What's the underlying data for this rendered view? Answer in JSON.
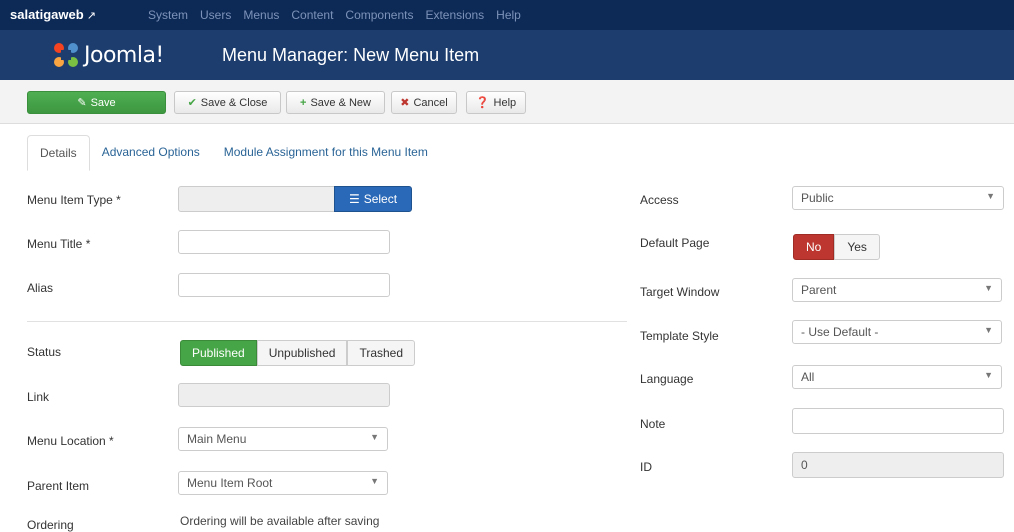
{
  "topnav": {
    "site": "salatigaweb",
    "external_icon": "external-link-icon",
    "menu": [
      "System",
      "Users",
      "Menus",
      "Content",
      "Components",
      "Extensions",
      "Help"
    ]
  },
  "header": {
    "logo_text": "Joomla!",
    "title": "Menu Manager: New Menu Item"
  },
  "toolbar": {
    "save": "Save",
    "save_close": "Save & Close",
    "save_new": "Save & New",
    "cancel": "Cancel",
    "help": "Help"
  },
  "tabs": [
    "Details",
    "Advanced Options",
    "Module Assignment for this Menu Item"
  ],
  "left": {
    "menu_item_type_label": "Menu Item Type *",
    "select_label": "Select",
    "menu_title_label": "Menu Title *",
    "alias_label": "Alias",
    "status_label": "Status",
    "status_options": [
      "Published",
      "Unpublished",
      "Trashed"
    ],
    "link_label": "Link",
    "menu_location_label": "Menu Location *",
    "menu_location_value": "Main Menu",
    "parent_item_label": "Parent Item",
    "parent_item_value": "Menu Item Root",
    "ordering_label": "Ordering",
    "ordering_note": "Ordering will be available after saving"
  },
  "right": {
    "access_label": "Access",
    "access_value": "Public",
    "default_page_label": "Default Page",
    "default_no": "No",
    "default_yes": "Yes",
    "target_window_label": "Target Window",
    "target_window_value": "Parent",
    "template_style_label": "Template Style",
    "template_style_value": "- Use Default -",
    "language_label": "Language",
    "language_value": "All",
    "note_label": "Note",
    "id_label": "ID",
    "id_value": "0"
  },
  "colors": {
    "topnav_bg": "#0d2a57",
    "header_bg": "#1c3d6e",
    "save_green": "#46a546",
    "select_blue": "#2a69b8",
    "no_red": "#bd362f"
  }
}
